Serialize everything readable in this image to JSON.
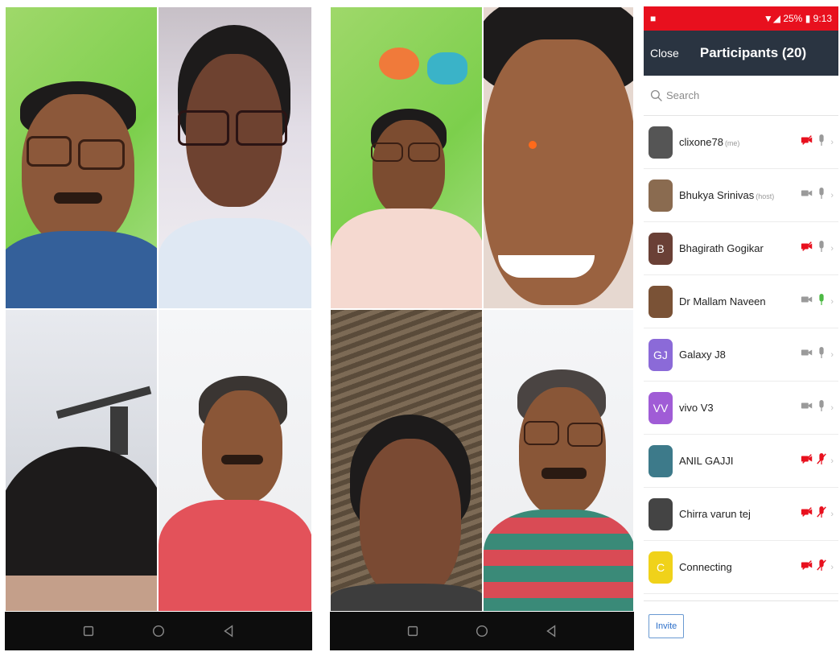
{
  "phones": {
    "left": {
      "tiles": [
        "video-top-left",
        "video-top-right",
        "video-bottom-left",
        "video-bottom-right"
      ]
    },
    "middle": {
      "tiles": [
        "video-top-left",
        "video-top-right",
        "video-bottom-left",
        "video-bottom-right"
      ]
    }
  },
  "navbar": {
    "icons": [
      "square-icon",
      "circle-icon",
      "triangle-back-icon"
    ]
  },
  "participants": {
    "status_bar": {
      "time": "9:13",
      "battery": "25%"
    },
    "close_label": "Close",
    "title": "Participants (20)",
    "search_placeholder": "Search",
    "list": [
      {
        "name": "clixone78",
        "tag": "(me)",
        "avatar_letter": "",
        "avatar_color": "#555555",
        "video": "off-red",
        "mic": "on-gray"
      },
      {
        "name": "Bhukya Srinivas",
        "tag": "(host)",
        "avatar_letter": "",
        "avatar_color": "#8a6b50",
        "video": "on-gray",
        "mic": "on-gray"
      },
      {
        "name": "Bhagirath Gogikar",
        "tag": "",
        "avatar_letter": "B",
        "avatar_color": "#6a4036",
        "video": "off-red",
        "mic": "on-gray"
      },
      {
        "name": "Dr Mallam Naveen",
        "tag": "",
        "avatar_letter": "",
        "avatar_color": "#7a5236",
        "video": "on-gray",
        "mic": "on-green"
      },
      {
        "name": "Galaxy J8",
        "tag": "",
        "avatar_letter": "GJ",
        "avatar_color": "#8b6ad8",
        "video": "on-gray",
        "mic": "on-gray"
      },
      {
        "name": "vivo V3",
        "tag": "",
        "avatar_letter": "VV",
        "avatar_color": "#a05cd6",
        "video": "on-gray",
        "mic": "on-gray"
      },
      {
        "name": "ANIL GAJJI",
        "tag": "",
        "avatar_letter": "",
        "avatar_color": "#3d7a8a",
        "video": "off-red",
        "mic": "off-red"
      },
      {
        "name": "Chirra varun tej",
        "tag": "",
        "avatar_letter": "",
        "avatar_color": "#444444",
        "video": "off-red",
        "mic": "off-red"
      },
      {
        "name": "Connecting",
        "tag": "",
        "avatar_letter": "C",
        "avatar_color": "#f0d21a",
        "video": "off-red",
        "mic": "off-red"
      }
    ],
    "invite_label": "Invite",
    "colors": {
      "red": "#e8101e",
      "header": "#2a3441",
      "green": "#4cb944",
      "gray": "#9a9a9a"
    }
  }
}
